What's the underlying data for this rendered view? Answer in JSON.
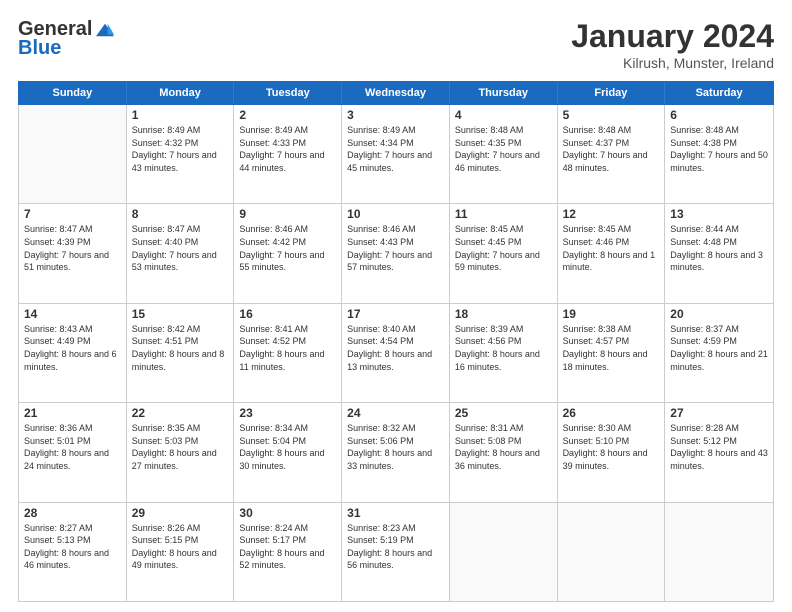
{
  "logo": {
    "general": "General",
    "blue": "Blue"
  },
  "title": "January 2024",
  "subtitle": "Kilrush, Munster, Ireland",
  "weekdays": [
    "Sunday",
    "Monday",
    "Tuesday",
    "Wednesday",
    "Thursday",
    "Friday",
    "Saturday"
  ],
  "rows": [
    [
      {
        "day": "",
        "empty": true
      },
      {
        "day": "1",
        "sunrise": "Sunrise: 8:49 AM",
        "sunset": "Sunset: 4:32 PM",
        "daylight": "Daylight: 7 hours and 43 minutes."
      },
      {
        "day": "2",
        "sunrise": "Sunrise: 8:49 AM",
        "sunset": "Sunset: 4:33 PM",
        "daylight": "Daylight: 7 hours and 44 minutes."
      },
      {
        "day": "3",
        "sunrise": "Sunrise: 8:49 AM",
        "sunset": "Sunset: 4:34 PM",
        "daylight": "Daylight: 7 hours and 45 minutes."
      },
      {
        "day": "4",
        "sunrise": "Sunrise: 8:48 AM",
        "sunset": "Sunset: 4:35 PM",
        "daylight": "Daylight: 7 hours and 46 minutes."
      },
      {
        "day": "5",
        "sunrise": "Sunrise: 8:48 AM",
        "sunset": "Sunset: 4:37 PM",
        "daylight": "Daylight: 7 hours and 48 minutes."
      },
      {
        "day": "6",
        "sunrise": "Sunrise: 8:48 AM",
        "sunset": "Sunset: 4:38 PM",
        "daylight": "Daylight: 7 hours and 50 minutes."
      }
    ],
    [
      {
        "day": "7",
        "sunrise": "Sunrise: 8:47 AM",
        "sunset": "Sunset: 4:39 PM",
        "daylight": "Daylight: 7 hours and 51 minutes."
      },
      {
        "day": "8",
        "sunrise": "Sunrise: 8:47 AM",
        "sunset": "Sunset: 4:40 PM",
        "daylight": "Daylight: 7 hours and 53 minutes."
      },
      {
        "day": "9",
        "sunrise": "Sunrise: 8:46 AM",
        "sunset": "Sunset: 4:42 PM",
        "daylight": "Daylight: 7 hours and 55 minutes."
      },
      {
        "day": "10",
        "sunrise": "Sunrise: 8:46 AM",
        "sunset": "Sunset: 4:43 PM",
        "daylight": "Daylight: 7 hours and 57 minutes."
      },
      {
        "day": "11",
        "sunrise": "Sunrise: 8:45 AM",
        "sunset": "Sunset: 4:45 PM",
        "daylight": "Daylight: 7 hours and 59 minutes."
      },
      {
        "day": "12",
        "sunrise": "Sunrise: 8:45 AM",
        "sunset": "Sunset: 4:46 PM",
        "daylight": "Daylight: 8 hours and 1 minute."
      },
      {
        "day": "13",
        "sunrise": "Sunrise: 8:44 AM",
        "sunset": "Sunset: 4:48 PM",
        "daylight": "Daylight: 8 hours and 3 minutes."
      }
    ],
    [
      {
        "day": "14",
        "sunrise": "Sunrise: 8:43 AM",
        "sunset": "Sunset: 4:49 PM",
        "daylight": "Daylight: 8 hours and 6 minutes."
      },
      {
        "day": "15",
        "sunrise": "Sunrise: 8:42 AM",
        "sunset": "Sunset: 4:51 PM",
        "daylight": "Daylight: 8 hours and 8 minutes."
      },
      {
        "day": "16",
        "sunrise": "Sunrise: 8:41 AM",
        "sunset": "Sunset: 4:52 PM",
        "daylight": "Daylight: 8 hours and 11 minutes."
      },
      {
        "day": "17",
        "sunrise": "Sunrise: 8:40 AM",
        "sunset": "Sunset: 4:54 PM",
        "daylight": "Daylight: 8 hours and 13 minutes."
      },
      {
        "day": "18",
        "sunrise": "Sunrise: 8:39 AM",
        "sunset": "Sunset: 4:56 PM",
        "daylight": "Daylight: 8 hours and 16 minutes."
      },
      {
        "day": "19",
        "sunrise": "Sunrise: 8:38 AM",
        "sunset": "Sunset: 4:57 PM",
        "daylight": "Daylight: 8 hours and 18 minutes."
      },
      {
        "day": "20",
        "sunrise": "Sunrise: 8:37 AM",
        "sunset": "Sunset: 4:59 PM",
        "daylight": "Daylight: 8 hours and 21 minutes."
      }
    ],
    [
      {
        "day": "21",
        "sunrise": "Sunrise: 8:36 AM",
        "sunset": "Sunset: 5:01 PM",
        "daylight": "Daylight: 8 hours and 24 minutes."
      },
      {
        "day": "22",
        "sunrise": "Sunrise: 8:35 AM",
        "sunset": "Sunset: 5:03 PM",
        "daylight": "Daylight: 8 hours and 27 minutes."
      },
      {
        "day": "23",
        "sunrise": "Sunrise: 8:34 AM",
        "sunset": "Sunset: 5:04 PM",
        "daylight": "Daylight: 8 hours and 30 minutes."
      },
      {
        "day": "24",
        "sunrise": "Sunrise: 8:32 AM",
        "sunset": "Sunset: 5:06 PM",
        "daylight": "Daylight: 8 hours and 33 minutes."
      },
      {
        "day": "25",
        "sunrise": "Sunrise: 8:31 AM",
        "sunset": "Sunset: 5:08 PM",
        "daylight": "Daylight: 8 hours and 36 minutes."
      },
      {
        "day": "26",
        "sunrise": "Sunrise: 8:30 AM",
        "sunset": "Sunset: 5:10 PM",
        "daylight": "Daylight: 8 hours and 39 minutes."
      },
      {
        "day": "27",
        "sunrise": "Sunrise: 8:28 AM",
        "sunset": "Sunset: 5:12 PM",
        "daylight": "Daylight: 8 hours and 43 minutes."
      }
    ],
    [
      {
        "day": "28",
        "sunrise": "Sunrise: 8:27 AM",
        "sunset": "Sunset: 5:13 PM",
        "daylight": "Daylight: 8 hours and 46 minutes."
      },
      {
        "day": "29",
        "sunrise": "Sunrise: 8:26 AM",
        "sunset": "Sunset: 5:15 PM",
        "daylight": "Daylight: 8 hours and 49 minutes."
      },
      {
        "day": "30",
        "sunrise": "Sunrise: 8:24 AM",
        "sunset": "Sunset: 5:17 PM",
        "daylight": "Daylight: 8 hours and 52 minutes."
      },
      {
        "day": "31",
        "sunrise": "Sunrise: 8:23 AM",
        "sunset": "Sunset: 5:19 PM",
        "daylight": "Daylight: 8 hours and 56 minutes."
      },
      {
        "day": "",
        "empty": true
      },
      {
        "day": "",
        "empty": true
      },
      {
        "day": "",
        "empty": true
      }
    ]
  ]
}
